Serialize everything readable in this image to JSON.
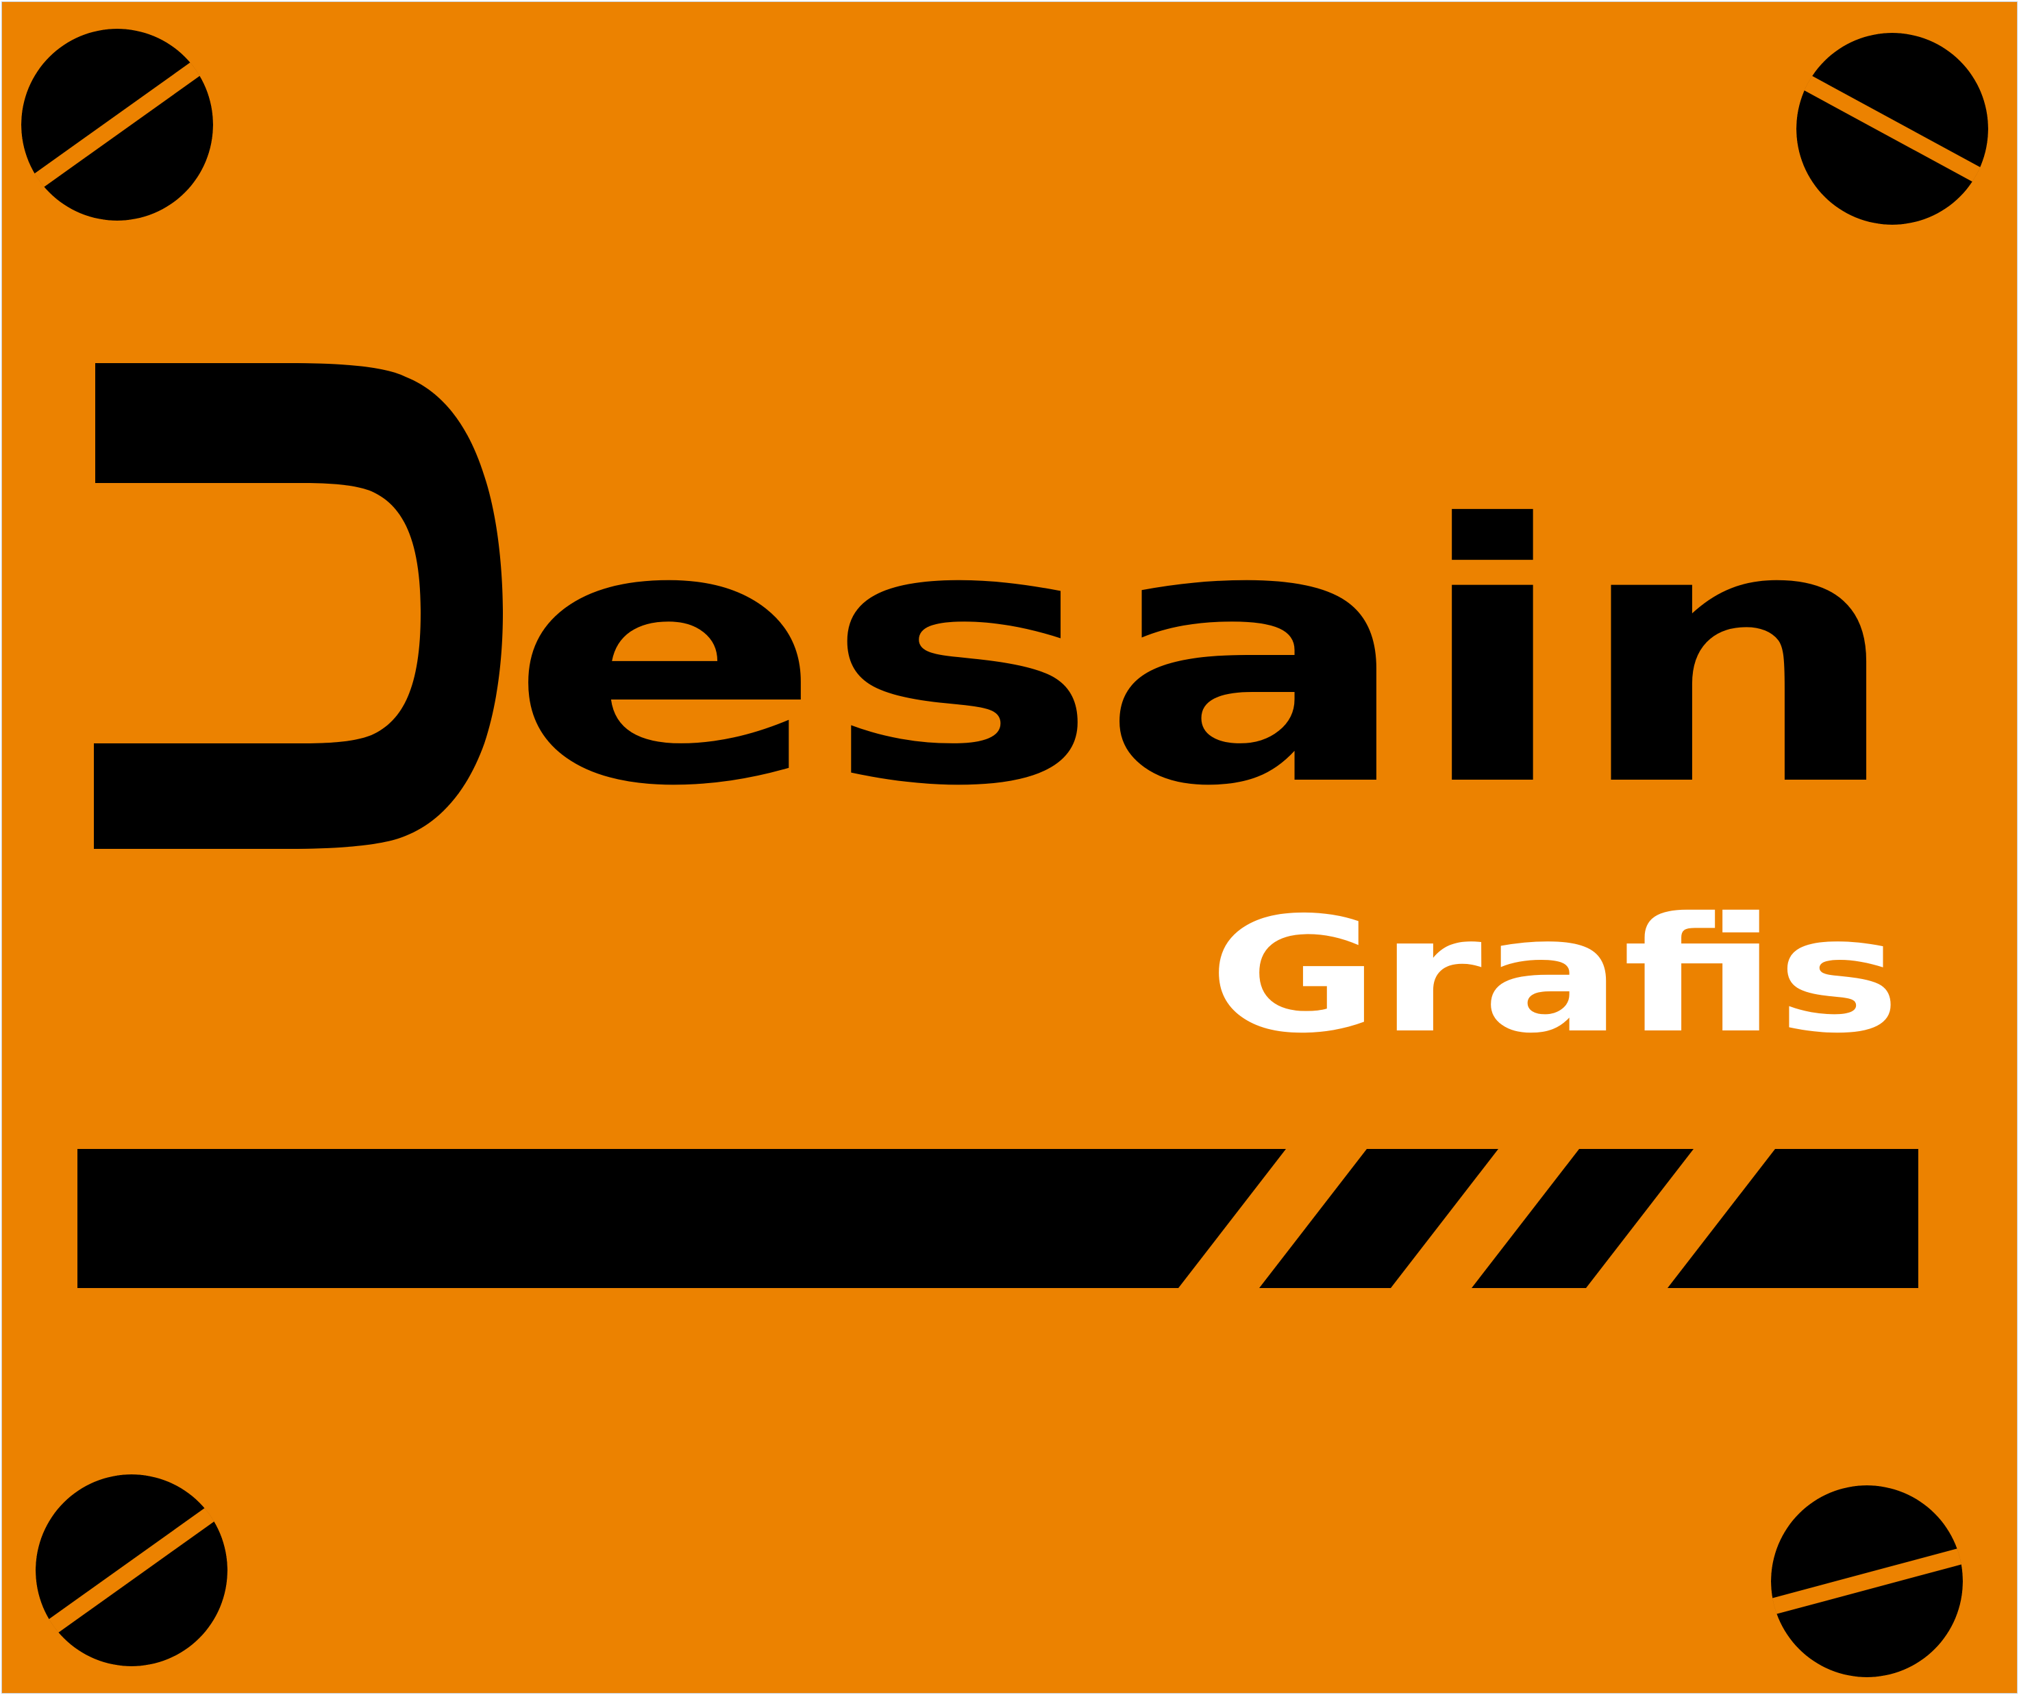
{
  "logo": {
    "title": "Desain",
    "subtitle": "Grafis"
  },
  "colors": {
    "background": "#EC8200",
    "ink": "#000000",
    "subtitle": "#FFFFFF"
  },
  "icons": {
    "corner_marks": [
      "screw-head-icon",
      "screw-head-icon",
      "screw-head-icon",
      "screw-head-icon"
    ],
    "underline": "striped-bar"
  }
}
